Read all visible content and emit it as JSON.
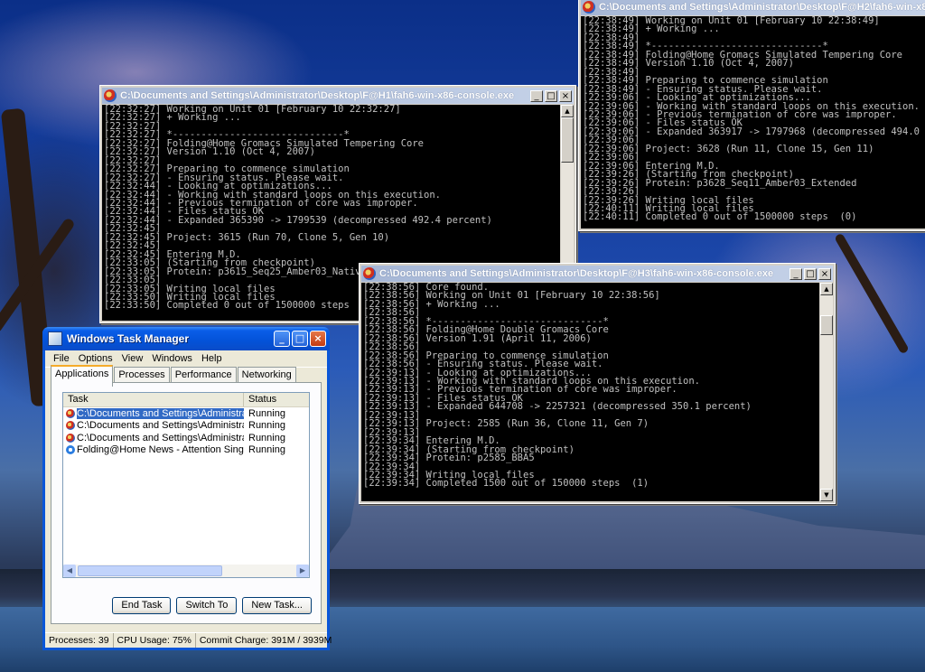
{
  "console1": {
    "title": "C:\\Documents and Settings\\Administrator\\Desktop\\F@H1\\fah6-win-x86-console.exe",
    "lines": [
      "[22:32:27] Working on Unit 01 [February 10 22:32:27]",
      "[22:32:27] + Working ...",
      "[22:32:27]",
      "[22:32:27] *------------------------------*",
      "[22:32:27] Folding@Home Gromacs Simulated Tempering Core",
      "[22:32:27] Version 1.10 (Oct 4, 2007)",
      "[22:32:27]",
      "[22:32:27] Preparing to commence simulation",
      "[22:32:27] - Ensuring status. Please wait.",
      "[22:32:44] - Looking at optimizations...",
      "[22:32:44] - Working with standard loops on this execution.",
      "[22:32:44] - Previous termination of core was improper.",
      "[22:32:44] - Files status OK",
      "[22:32:44] - Expanded 365390 -> 1799539 (decompressed 492.4 percent)",
      "[22:32:45]",
      "[22:32:45] Project: 3615 (Run 70, Clone 5, Gen 10)",
      "[22:32:45]",
      "[22:32:45] Entering M.D.",
      "[22:33:05] (Starting from checkpoint)",
      "[22:33:05] Protein: p3615_Seq25_Amber03_Nativ",
      "[22:33:05]",
      "[22:33:05] Writing local files",
      "[22:33:50] Writing local files",
      "[22:33:50] Completed 0 out of 1500000 steps"
    ]
  },
  "console2": {
    "title": "C:\\Documents and Settings\\Administrator\\Desktop\\F@H2\\fah6-win-x86-co",
    "lines": [
      "[22:38:49] Working on Unit 01 [February 10 22:38:49]",
      "[22:38:49] + Working ...",
      "[22:38:49]",
      "[22:38:49] *------------------------------*",
      "[22:38:49] Folding@Home Gromacs Simulated Tempering Core",
      "[22:38:49] Version 1.10 (Oct 4, 2007)",
      "[22:38:49]",
      "[22:38:49] Preparing to commence simulation",
      "[22:38:49] - Ensuring status. Please wait.",
      "[22:39:06] - Looking at optimizations...",
      "[22:39:06] - Working with standard loops on this execution.",
      "[22:39:06] - Previous termination of core was improper.",
      "[22:39:06] - Files status OK",
      "[22:39:06] - Expanded 363917 -> 1797968 (decompressed 494.0",
      "[22:39:06]",
      "[22:39:06] Project: 3628 (Run 11, Clone 15, Gen 11)",
      "[22:39:06]",
      "[22:39:06] Entering M.D.",
      "[22:39:26] (Starting from checkpoint)",
      "[22:39:26] Protein: p3628_Seq11_Amber03_Extended",
      "[22:39:26]",
      "[22:39:26] Writing local files",
      "[22:40:11] Writing local files",
      "[22:40:11] Completed 0 out of 1500000 steps  (0)"
    ]
  },
  "console3": {
    "title": "C:\\Documents and Settings\\Administrator\\Desktop\\F@H3\\fah6-win-x86-console.exe",
    "lines": [
      "[22:38:56] Core found.",
      "[22:38:56] Working on Unit 01 [February 10 22:38:56]",
      "[22:38:56] + Working ...",
      "[22:38:56]",
      "[22:38:56] *------------------------------*",
      "[22:38:56] Folding@Home Double Gromacs Core",
      "[22:38:56] Version 1.91 (April 11, 2006)",
      "[22:38:56]",
      "[22:38:56] Preparing to commence simulation",
      "[22:38:56] - Ensuring status. Please wait.",
      "[22:39:13] - Looking at optimizations...",
      "[22:39:13] - Working with standard loops on this execution.",
      "[22:39:13] - Previous termination of core was improper.",
      "[22:39:13] - Files status OK",
      "[22:39:13] - Expanded 644708 -> 2257321 (decompressed 350.1 percent)",
      "[22:39:13]",
      "[22:39:13] Project: 2585 (Run 36, Clone 11, Gen 7)",
      "[22:39:13]",
      "[22:39:34] Entering M.D.",
      "[22:39:34] (Starting from checkpoint)",
      "[22:39:34] Protein: p2585_BBA5",
      "[22:39:34]",
      "[22:39:34] Writing local files",
      "[22:39:34] Completed 1500 out of 150000 steps  (1)"
    ]
  },
  "taskmgr": {
    "title": "Windows Task Manager",
    "menu": [
      "File",
      "Options",
      "View",
      "Windows",
      "Help"
    ],
    "tabs": [
      "Applications",
      "Processes",
      "Performance",
      "Networking"
    ],
    "columns": {
      "task": "Task",
      "status": "Status"
    },
    "rows": [
      {
        "task": "C:\\Documents and Settings\\Administrator\\De...",
        "status": "Running",
        "icon": "fah-icon"
      },
      {
        "task": "C:\\Documents and Settings\\Administrator\\De...",
        "status": "Running",
        "icon": "fah-icon"
      },
      {
        "task": "C:\\Documents and Settings\\Administrator\\De...",
        "status": "Running",
        "icon": "fah-icon"
      },
      {
        "task": "Folding@Home News - Attention Single-Machi...",
        "status": "Running",
        "icon": "ie-icon"
      }
    ],
    "buttons": {
      "end_task": "End Task",
      "switch_to": "Switch To",
      "new_task": "New Task..."
    },
    "status": {
      "processes": "Processes: 39",
      "cpu": "CPU Usage: 75%",
      "commit": "Commit Charge: 391M / 3939M"
    }
  }
}
